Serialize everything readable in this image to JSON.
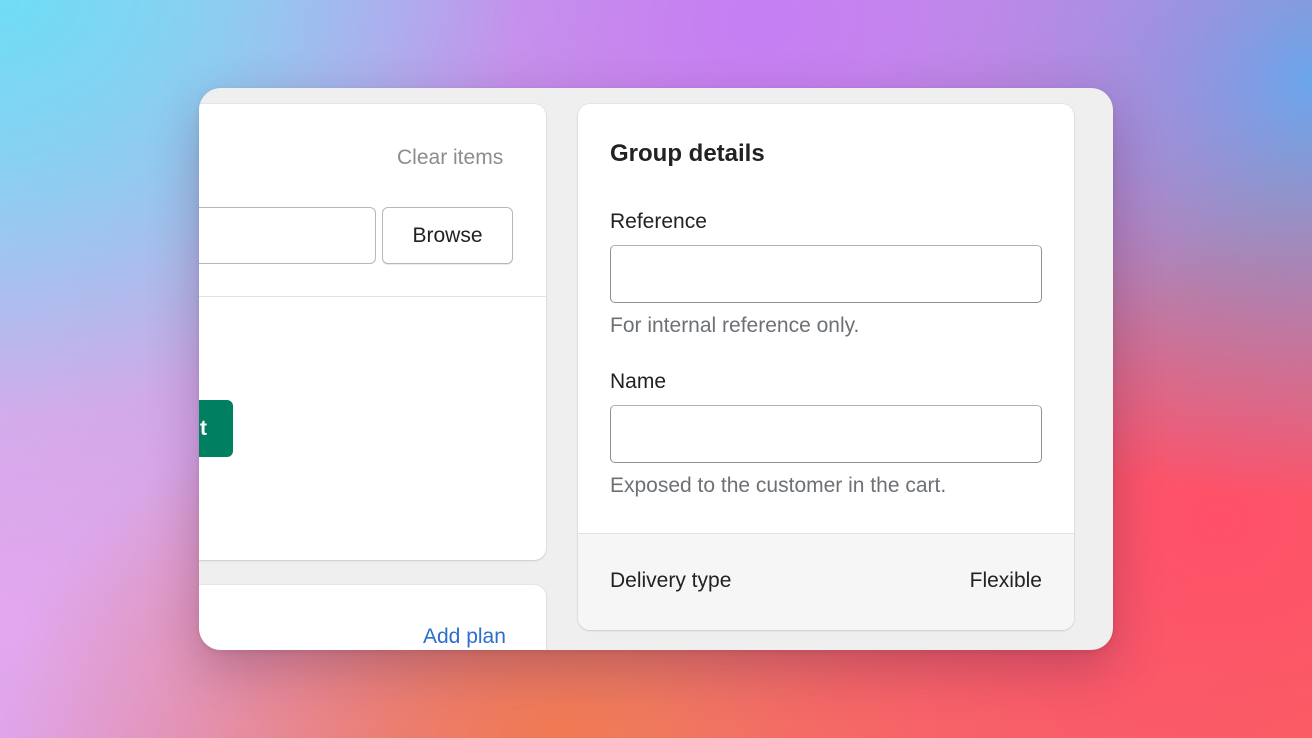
{
  "products_card": {
    "clear_items_label": "Clear items",
    "search_value": "",
    "browse_label": "Browse",
    "primary_button_label": "t"
  },
  "plans_card": {
    "add_plan_label": "Add plan"
  },
  "group_details": {
    "title": "Group details",
    "reference": {
      "label": "Reference",
      "value": "",
      "help": "For internal reference only."
    },
    "name": {
      "label": "Name",
      "value": "",
      "help": "Exposed to the customer in the cart."
    },
    "delivery_type": {
      "label": "Delivery type",
      "value": "Flexible"
    }
  },
  "colors": {
    "primary_green": "#008060",
    "link_blue": "#2c6ecb",
    "muted_text": "#6d7175"
  }
}
